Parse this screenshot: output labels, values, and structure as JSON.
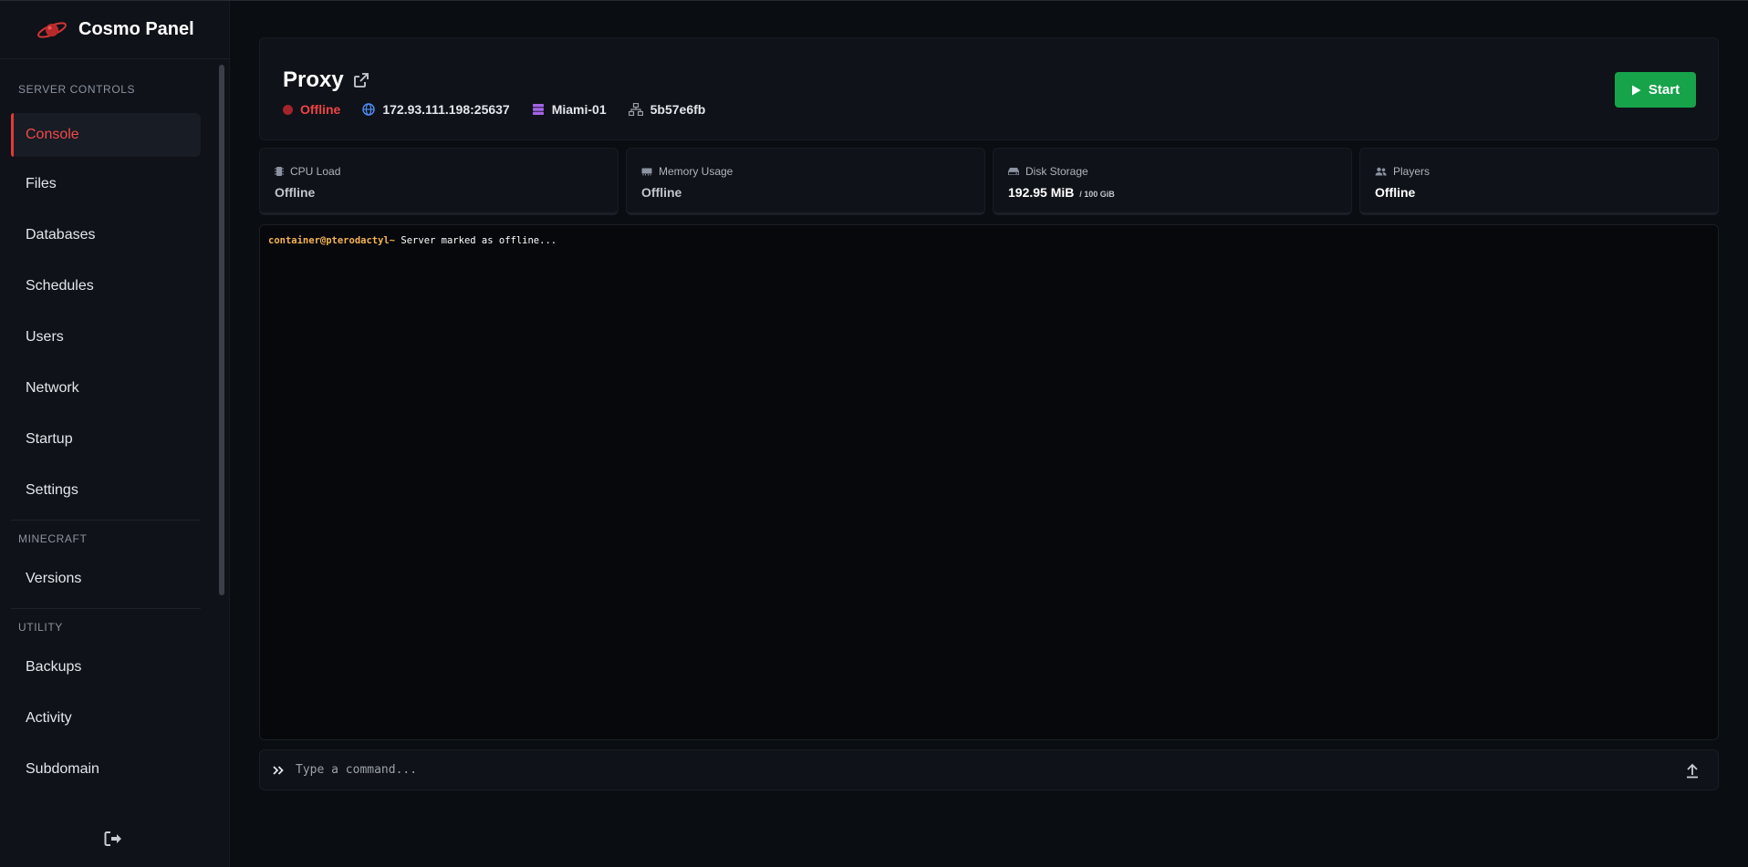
{
  "brand": {
    "name": "Cosmo Panel"
  },
  "sidebar": {
    "sections": [
      {
        "label": "SERVER CONTROLS"
      },
      {
        "label": "MINECRAFT"
      },
      {
        "label": "UTILITY"
      }
    ],
    "items": [
      {
        "label": "Console",
        "active": true
      },
      {
        "label": "Files"
      },
      {
        "label": "Databases"
      },
      {
        "label": "Schedules"
      },
      {
        "label": "Users"
      },
      {
        "label": "Network"
      },
      {
        "label": "Startup"
      },
      {
        "label": "Settings"
      },
      {
        "label": "Versions"
      },
      {
        "label": "Backups"
      },
      {
        "label": "Activity"
      },
      {
        "label": "Subdomain"
      }
    ]
  },
  "server": {
    "name": "Proxy",
    "status": "Offline",
    "address": "172.93.111.198:25637",
    "node": "Miami-01",
    "id": "5b57e6fb",
    "start_label": "Start"
  },
  "stats": {
    "cpu": {
      "label": "CPU Load",
      "value": "Offline"
    },
    "memory": {
      "label": "Memory Usage",
      "value": "Offline"
    },
    "disk": {
      "label": "Disk Storage",
      "value": "192.95 MiB",
      "limit": "/ 100 GiB"
    },
    "players": {
      "label": "Players",
      "value": "Offline"
    }
  },
  "console": {
    "prompt": "container@pterodactyl~",
    "message": "Server marked as offline..."
  },
  "command": {
    "placeholder": "Type a command..."
  },
  "colors": {
    "accent": "#e23a3a",
    "start": "#16a34a",
    "prompt": "#f3b352",
    "status_offline": "#ef4444"
  }
}
